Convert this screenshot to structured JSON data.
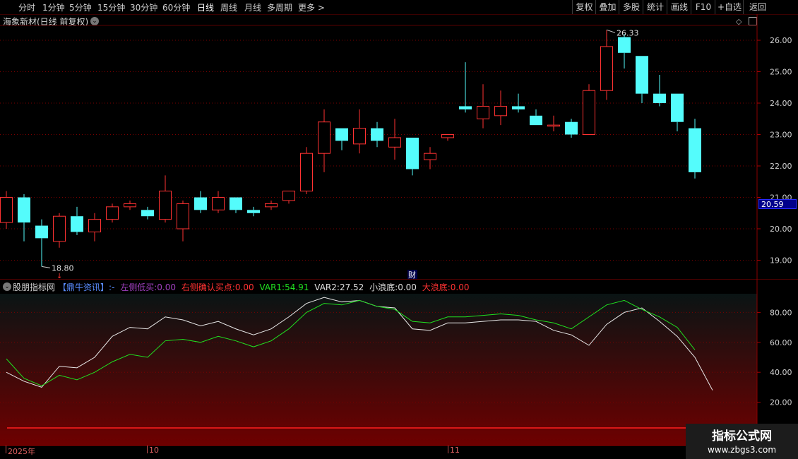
{
  "toolbar": {
    "periods": [
      "分时",
      "1分钟",
      "5分钟",
      "15分钟",
      "30分钟",
      "60分钟",
      "日线",
      "周线",
      "月线",
      "多周期",
      "更多 >"
    ],
    "active_period": "日线",
    "right_buttons": [
      "复权",
      "叠加",
      "多股",
      "统计",
      "画线",
      "F10",
      "+自选",
      "返回"
    ]
  },
  "chart": {
    "title": "海象新材(日线 前复权)",
    "max_label": "26.33",
    "min_label": "18.80",
    "current_price": "20.59",
    "fin_marker": "财",
    "price_axis": [
      "26.00",
      "25.00",
      "24.00",
      "23.00",
      "22.00",
      "21.00",
      "20.00",
      "19.00"
    ],
    "colors": {
      "up": "#ff3232",
      "down": "#54fcfc",
      "grid": "#7a0000",
      "axis_text": "#d0d0d0"
    }
  },
  "candles": [
    {
      "o": 20.2,
      "h": 21.2,
      "l": 20.0,
      "c": 21.0
    },
    {
      "o": 21.0,
      "h": 21.1,
      "l": 19.6,
      "c": 20.2
    },
    {
      "o": 20.1,
      "h": 20.3,
      "l": 18.8,
      "c": 19.7
    },
    {
      "o": 19.6,
      "h": 20.5,
      "l": 19.4,
      "c": 20.4
    },
    {
      "o": 20.4,
      "h": 20.7,
      "l": 19.8,
      "c": 19.9
    },
    {
      "o": 19.9,
      "h": 20.5,
      "l": 19.6,
      "c": 20.3
    },
    {
      "o": 20.3,
      "h": 20.8,
      "l": 20.2,
      "c": 20.7
    },
    {
      "o": 20.7,
      "h": 20.9,
      "l": 20.6,
      "c": 20.8
    },
    {
      "o": 20.6,
      "h": 20.7,
      "l": 20.3,
      "c": 20.4
    },
    {
      "o": 20.3,
      "h": 21.7,
      "l": 20.2,
      "c": 21.2
    },
    {
      "o": 20.0,
      "h": 20.9,
      "l": 19.6,
      "c": 20.8
    },
    {
      "o": 21.0,
      "h": 21.2,
      "l": 20.5,
      "c": 20.6
    },
    {
      "o": 20.6,
      "h": 21.2,
      "l": 20.5,
      "c": 21.0
    },
    {
      "o": 21.0,
      "h": 21.0,
      "l": 20.5,
      "c": 20.6
    },
    {
      "o": 20.6,
      "h": 20.7,
      "l": 20.4,
      "c": 20.5
    },
    {
      "o": 20.7,
      "h": 20.9,
      "l": 20.6,
      "c": 20.8
    },
    {
      "o": 20.9,
      "h": 21.2,
      "l": 20.8,
      "c": 21.2
    },
    {
      "o": 21.2,
      "h": 22.6,
      "l": 21.1,
      "c": 22.4
    },
    {
      "o": 22.4,
      "h": 23.8,
      "l": 21.8,
      "c": 23.4
    },
    {
      "o": 23.2,
      "h": 23.2,
      "l": 22.5,
      "c": 22.8
    },
    {
      "o": 22.7,
      "h": 23.8,
      "l": 22.4,
      "c": 23.2
    },
    {
      "o": 23.2,
      "h": 23.4,
      "l": 22.6,
      "c": 22.8
    },
    {
      "o": 22.6,
      "h": 23.5,
      "l": 22.2,
      "c": 22.9
    },
    {
      "o": 22.9,
      "h": 22.9,
      "l": 21.7,
      "c": 21.9
    },
    {
      "o": 22.2,
      "h": 22.6,
      "l": 21.9,
      "c": 22.4
    },
    {
      "o": 22.9,
      "h": 23.0,
      "l": 22.8,
      "c": 23.0
    },
    {
      "o": 23.9,
      "h": 25.3,
      "l": 23.7,
      "c": 23.8
    },
    {
      "o": 23.5,
      "h": 24.6,
      "l": 23.2,
      "c": 23.9
    },
    {
      "o": 23.6,
      "h": 24.4,
      "l": 23.3,
      "c": 23.9
    },
    {
      "o": 23.9,
      "h": 24.3,
      "l": 23.7,
      "c": 23.8
    },
    {
      "o": 23.6,
      "h": 23.8,
      "l": 23.3,
      "c": 23.3
    },
    {
      "o": 23.3,
      "h": 23.6,
      "l": 23.1,
      "c": 23.3
    },
    {
      "o": 23.4,
      "h": 23.5,
      "l": 22.9,
      "c": 23.0
    },
    {
      "o": 23.0,
      "h": 24.6,
      "l": 23.0,
      "c": 24.4
    },
    {
      "o": 24.4,
      "h": 26.33,
      "l": 24.1,
      "c": 25.8
    },
    {
      "o": 26.1,
      "h": 26.2,
      "l": 25.1,
      "c": 25.6
    },
    {
      "o": 25.5,
      "h": 25.5,
      "l": 24.0,
      "c": 24.3
    },
    {
      "o": 24.3,
      "h": 24.9,
      "l": 23.9,
      "c": 24.0
    },
    {
      "o": 24.3,
      "h": 24.3,
      "l": 23.1,
      "c": 23.4
    },
    {
      "o": 23.2,
      "h": 23.5,
      "l": 21.6,
      "c": 21.8
    }
  ],
  "indicator": {
    "name": "股朋指标网",
    "source": "【鼎牛资讯】",
    "dash": ":-",
    "left_buy_label": "左侧低买:",
    "left_buy_value": "0.00",
    "right_buy_label": "右侧确认买点:",
    "right_buy_value": "0.00",
    "var1_label": "VAR1:",
    "var1_value": "54.91",
    "var2_label": "VAR2:",
    "var2_value": "27.52",
    "small_label": "小浪底:",
    "small_value": "0.00",
    "big_label": "大浪底:",
    "big_value": "0.00",
    "axis": [
      "80.00",
      "60.00",
      "40.00",
      "20.00"
    ],
    "colors": {
      "name": "#d0d0d0",
      "source": "#5a8cff",
      "left": "#a040c0",
      "right": "#ff3232",
      "var1": "#20e020",
      "var2": "#e0e0e0",
      "small": "#e0e0e0",
      "big": "#ff3232"
    },
    "ylim": [
      0,
      100
    ],
    "var1": [
      49,
      36,
      31,
      38,
      35,
      40,
      47,
      52,
      50,
      61,
      62,
      60,
      64,
      61,
      57,
      61,
      69,
      80,
      86,
      85,
      88,
      84,
      82,
      74,
      73,
      77,
      77,
      78,
      79,
      78,
      75,
      73,
      69,
      77,
      85,
      88,
      82,
      77,
      70,
      55
    ],
    "var2": [
      40,
      34,
      30,
      44,
      43,
      50,
      64,
      70,
      69,
      77,
      75,
      71,
      74,
      69,
      65,
      69,
      77,
      86,
      90,
      87,
      88,
      84,
      83,
      69,
      68,
      73,
      73,
      74,
      75,
      75,
      74,
      68,
      65,
      58,
      72,
      80,
      83,
      74,
      64,
      50,
      28
    ]
  },
  "timeaxis": {
    "labels": [
      "2025年",
      "10",
      "11"
    ]
  },
  "watermark": {
    "line1": "指标公式网",
    "line2": "www.zbgs3.com"
  }
}
